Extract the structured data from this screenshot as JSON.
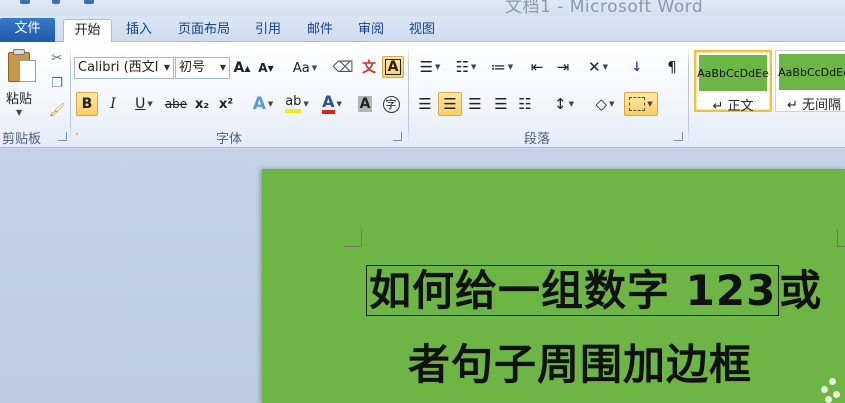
{
  "window": {
    "title": "文档1 - Microsoft Word"
  },
  "tabs": {
    "file": "文件",
    "home": "开始",
    "insert": "插入",
    "layout": "页面布局",
    "references": "引用",
    "mailings": "邮件",
    "review": "审阅",
    "view": "视图"
  },
  "clipboard": {
    "paste_label": "粘贴",
    "group_label": "剪贴板"
  },
  "font": {
    "name": "Calibri (西文I",
    "size": "初号",
    "group_label": "字体",
    "grow_label": "A",
    "shrink_label": "A",
    "case_label": "Aa",
    "bold": "B",
    "italic": "I",
    "underline": "U",
    "strike": "abe",
    "sub": "x₂",
    "sup": "x²",
    "effects": "A",
    "highlight": "ab",
    "color": "A",
    "shading": "A",
    "enclose": "字"
  },
  "paragraph": {
    "group_label": "段落"
  },
  "styles": {
    "items": [
      {
        "preview": "AaBbCcDdEe",
        "name": "↵ 正文"
      },
      {
        "preview": "AaBbCcDdEe",
        "name": "↵ 无间隔"
      }
    ]
  },
  "document": {
    "line1_pre": "如何给一组数字 ",
    "line1_digits": "123",
    "line1_post": "或",
    "line2": "者句子周围加边框"
  },
  "colors": {
    "page_green": "#6db646",
    "ribbon_blue": "#15428b",
    "active_button": "#f9cf62"
  }
}
